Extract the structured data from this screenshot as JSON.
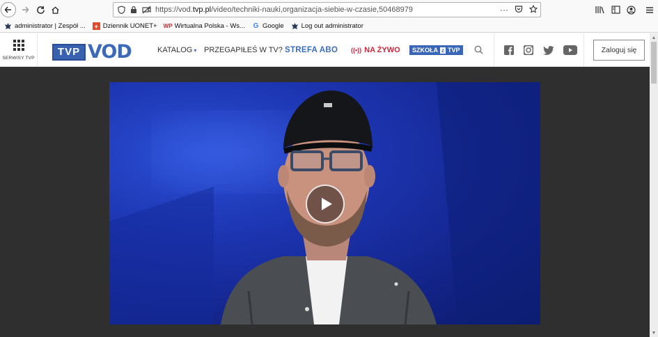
{
  "browser": {
    "url_prefix": "https://vod.",
    "url_host": "tvp.pl",
    "url_path": "/video/techniki-nauki,organizacja-siebie-w-czasie,50468979",
    "url_more": "···"
  },
  "bookmarks": [
    {
      "label": "administrator | Zespół ...",
      "icon": "eagle-icon"
    },
    {
      "label": "Dziennik UONET+",
      "icon": "cross-icon"
    },
    {
      "label": "Wirtualna Polska - Ws...",
      "icon": "wp-icon"
    },
    {
      "label": "Google",
      "icon": "google-icon"
    },
    {
      "label": "Log out administrator",
      "icon": "eagle-icon"
    }
  ],
  "header": {
    "serwisy_label": "SERWISY TVP",
    "logo_tvp": "TVP",
    "logo_vod": "VOD",
    "menu_katalog": "KATALOG",
    "menu_katalog_arrow": "▾",
    "menu_przegapiles": "PRZEGAPIŁEŚ W TV?",
    "menu_strefa": "STREFA ABO",
    "menu_zywo_icon": "((•))",
    "menu_zywo": "NA ŻYWO",
    "menu_szkola": "SZKOŁA",
    "menu_szkola_z": "z",
    "menu_szkola_tvp": "TVP",
    "login_label": "Zaloguj się",
    "social": [
      "facebook-icon",
      "instagram-icon",
      "twitter-icon",
      "youtube-icon"
    ]
  },
  "colors": {
    "brand_blue": "#3861b0",
    "live_red": "#d2243a",
    "content_bg": "#2f2f2f"
  }
}
